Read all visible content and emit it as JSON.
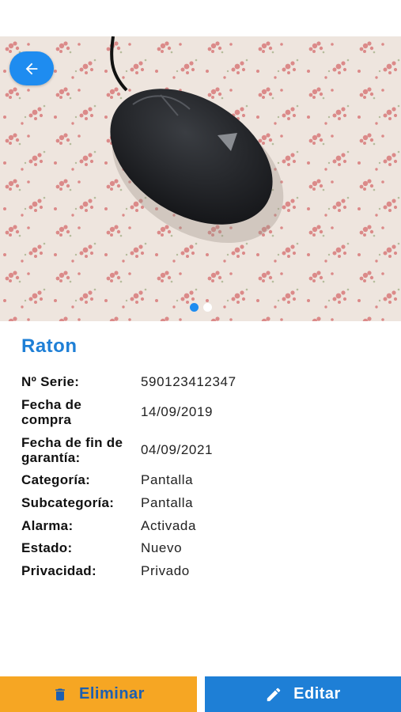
{
  "product": {
    "title": "Raton",
    "images_count": 2,
    "active_image": 1
  },
  "details": [
    {
      "label": "Nº Serie:",
      "value": "590123412347"
    },
    {
      "label": "Fecha de compra",
      "value": "14/09/2019"
    },
    {
      "label": "Fecha de fin de garantía:",
      "value": "04/09/2021"
    },
    {
      "label": "Categoría:",
      "value": "Pantalla"
    },
    {
      "label": "Subcategoría:",
      "value": "Pantalla"
    },
    {
      "label": "Alarma:",
      "value": "Activada"
    },
    {
      "label": "Estado:",
      "value": "Nuevo"
    },
    {
      "label": "Privacidad:",
      "value": "Privado"
    }
  ],
  "actions": {
    "delete_label": "Eliminar",
    "edit_label": "Editar"
  },
  "icons": {
    "back": "arrow-left-icon",
    "delete": "trash-icon",
    "edit": "pencil-icon"
  },
  "colors": {
    "primary": "#1e7fd6",
    "accent": "#f6a623",
    "text": "#111111"
  }
}
